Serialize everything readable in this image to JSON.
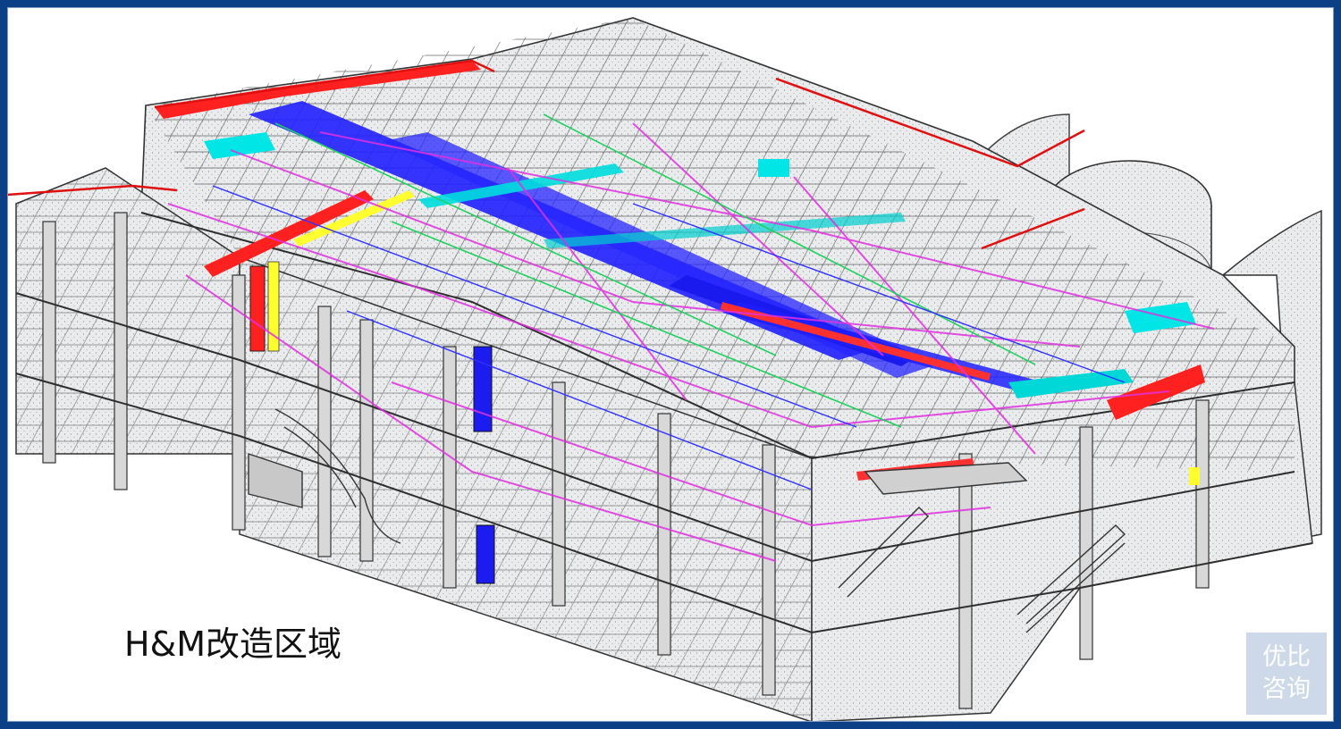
{
  "caption": "H&M改造区域",
  "watermark": {
    "line1": "优比",
    "line2": "咨询"
  },
  "colors": {
    "border": "#0b3f86",
    "structure": "#333333",
    "glass": "#cfd3d8",
    "duct_blue": "#2020ff",
    "duct_cyan": "#00e5e5",
    "duct_red": "#ff2020",
    "duct_magenta": "#e030e0",
    "duct_yellow": "#ffff30",
    "duct_green": "#20d060"
  },
  "icons": [
    "building-model-icon",
    "logo-watermark-icon"
  ]
}
